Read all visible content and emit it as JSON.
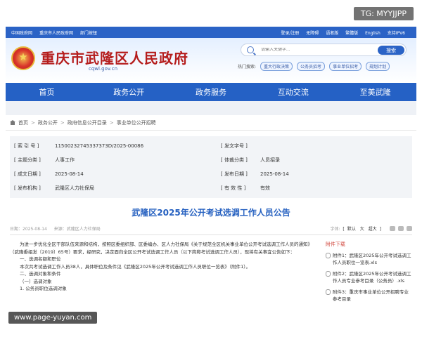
{
  "watermarks": {
    "top_right": "TG: MYYJJPP",
    "bottom_left": "www.page-yuyan.com"
  },
  "topbar": {
    "left": [
      "中国政府网",
      "重庆市人民政府网",
      "部门按钮"
    ],
    "right": [
      "登录/注册",
      "无障碍",
      "语者版",
      "繁體版",
      "English",
      "支持IPV6"
    ]
  },
  "header": {
    "site_title": "重庆市武隆区人民政府",
    "domain": "cqwl.gov.cn",
    "search": {
      "placeholder": "请输入关键字...",
      "button": "搜索"
    },
    "hot_label": "热门搜索:",
    "hot_tags": [
      "重大行政决策",
      "公务员招考",
      "事业单位招考",
      "规划计划"
    ]
  },
  "nav": [
    "首页",
    "政务公开",
    "政务服务",
    "互动交流",
    "至美武隆"
  ],
  "breadcrumb": [
    "首页",
    "政务公开",
    "政府信息公开目录",
    "事业单位公开招聘"
  ],
  "meta": [
    {
      "label": "[ 索 引 号 ]",
      "value": "11500232745337373D/2025-00086",
      "label2": "[ 发文字号 ]",
      "value2": ""
    },
    {
      "label": "[ 主题分类 ]",
      "value": "人事工作",
      "label2": "[ 体裁分类 ]",
      "value2": "人员招录"
    },
    {
      "label": "[ 成文日期 ]",
      "value": "2025-08-14",
      "label2": "[ 发布日期 ]",
      "value2": "2025-08-14"
    },
    {
      "label": "[ 发布机构 ]",
      "value": "武隆区人力社保局",
      "label2": "[ 有 效 性 ]",
      "value2": "有效"
    }
  ],
  "article": {
    "title": "武隆区2025年公开考试选调工作人员公告",
    "date": "日期：2025-08-14",
    "source": "来源：武隆区人力社保局",
    "font_label": "字体:",
    "font_sizes": [
      "默认",
      "大",
      "超大"
    ],
    "paragraphs": [
      "为进一步优化全区干部队伍来源和结构，按照区委组织部、区委编办、区人力社保局《关于规范全区机关事业单位公开考试选调工作人员的通知》（武隆委组发〔2019〕65号）要求，经研究，决定面向全区公开考试选调工作人员（以下简称考试选调工作人员），现将有关事宜公告如下：",
      "一、选调名额和职位",
      "本次共考试选调工作人员38人，具体职位及条件见《武隆区2025年公开考试选调工作人员职位一览表》（附件1）。",
      "二、选调对象和条件",
      "（一）选调对象",
      "1. 公务员职位选调对象"
    ]
  },
  "attachments": {
    "head": "附件下载",
    "items": [
      "附件1：武隆区2025年公开考试选调工作人员职位一览表.xls",
      "附件2：武隆区2025年公开考试选调工作人员专业参考目录（公务员）.xls",
      "附件3：重庆市事业单位公开招聘专业参考目录"
    ]
  }
}
